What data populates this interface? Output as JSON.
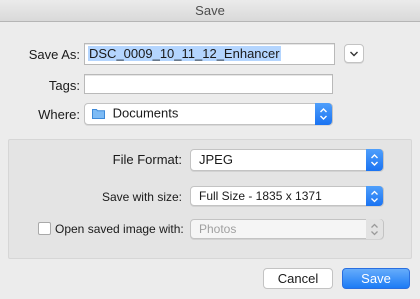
{
  "window": {
    "title": "Save"
  },
  "save_as": {
    "label": "Save As:",
    "value": "DSC_0009_10_11_12_Enhancer"
  },
  "tags": {
    "label": "Tags:",
    "value": ""
  },
  "where": {
    "label": "Where:",
    "value": "Documents",
    "icon": "folder-icon"
  },
  "options": {
    "file_format": {
      "label": "File Format:",
      "value": "JPEG"
    },
    "save_with_size": {
      "label": "Save with size:",
      "value": "Full Size - 1835 x 1371"
    },
    "open_with": {
      "label": "Open saved image with:",
      "value": "Photos",
      "checked": false
    }
  },
  "buttons": {
    "cancel": "Cancel",
    "save": "Save"
  },
  "colors": {
    "accent": "#1a73f2",
    "selection": "#b4d5fe"
  }
}
